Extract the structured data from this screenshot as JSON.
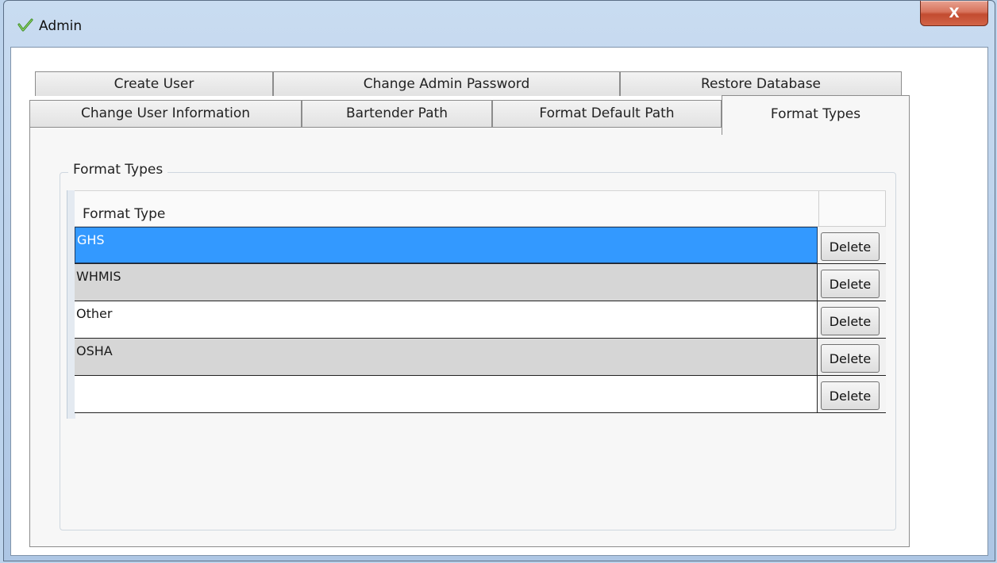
{
  "window": {
    "title": "Admin",
    "icon": "green-check-icon",
    "close_glyph": "X"
  },
  "tabs": {
    "row1": [
      {
        "label": "Create User"
      },
      {
        "label": "Change Admin Password"
      },
      {
        "label": "Restore Database"
      }
    ],
    "row2": [
      {
        "label": "Change User Information"
      },
      {
        "label": "Bartender Path"
      },
      {
        "label": "Format Default Path"
      },
      {
        "label": "Format Types",
        "selected": true
      }
    ]
  },
  "panel": {
    "group_title": "Format Types",
    "grid": {
      "column_header": "Format Type",
      "action_label": "Delete",
      "rows": [
        {
          "value": "GHS",
          "selected": true
        },
        {
          "value": "WHMIS"
        },
        {
          "value": "Other"
        },
        {
          "value": "OSHA"
        },
        {
          "value": ""
        }
      ]
    }
  },
  "colors": {
    "selection": "#3399ff",
    "alt_row": "#d6d6d6",
    "close_button": "#c24b30"
  }
}
